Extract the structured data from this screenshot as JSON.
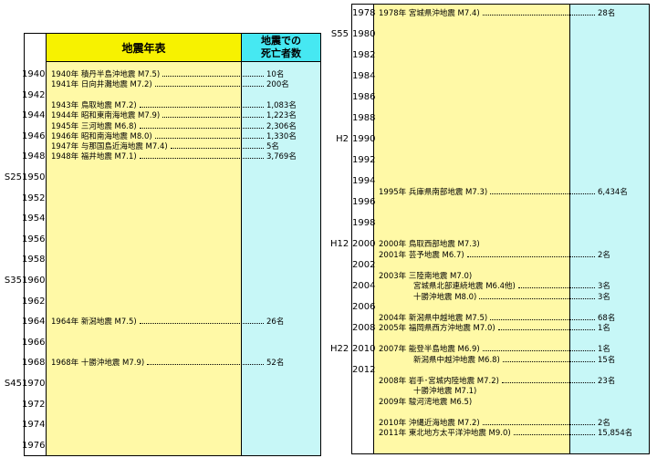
{
  "headers": {
    "main": "地震年表",
    "death": "地震での\n死亡者数"
  },
  "left": {
    "years": [
      "1940",
      "1942",
      "1944",
      "1946",
      "1948",
      "1950",
      "1952",
      "1954",
      "1956",
      "1958",
      "1960",
      "1962",
      "1964",
      "1966",
      "1968",
      "1970",
      "1972",
      "1974",
      "1976"
    ],
    "eras": [
      {
        "label": "S25",
        "year": "1950"
      },
      {
        "label": "S35",
        "year": "1960"
      },
      {
        "label": "S45",
        "year": "1970"
      }
    ],
    "events": [
      {
        "t": "1940年 積丹半島沖地震 M7.5)",
        "d": "10名",
        "row": 0.0
      },
      {
        "t": "1941年 日向井灘地震 M7.2)",
        "d": "200名",
        "row": 0.5
      },
      {
        "t": "1943年 鳥取地震 M7.2)",
        "d": "1,083名",
        "row": 1.5
      },
      {
        "t": "1944年 昭和東南海地震 M7.9)",
        "d": "1,223名",
        "row": 2.0
      },
      {
        "t": "1945年 三河地震 M6.8)",
        "d": "2,306名",
        "row": 2.5
      },
      {
        "t": "1946年 昭和南海地震 M8.0)",
        "d": "1,330名",
        "row": 3.0
      },
      {
        "t": "1947年 与那国島近海地震 M7.4)",
        "d": "5名",
        "row": 3.5
      },
      {
        "t": "1948年 福井地震 M7.1)",
        "d": "3,769名",
        "row": 4.0
      },
      {
        "t": "1964年 新潟地震 M7.5)",
        "d": "26名",
        "row": 12.0
      },
      {
        "t": "1968年 十勝沖地震 M7.9)",
        "d": "52名",
        "row": 14.0
      }
    ]
  },
  "right": {
    "years": [
      "1978",
      "1980",
      "1982",
      "1984",
      "1986",
      "1988",
      "1990",
      "1992",
      "1994",
      "1996",
      "1998",
      "2000",
      "2002",
      "2004",
      "2006",
      "2008",
      "2010",
      "2012"
    ],
    "eras": [
      {
        "label": "S55",
        "year": "1980"
      },
      {
        "label": "H2",
        "year": "1990"
      },
      {
        "label": "H12",
        "year": "2000"
      },
      {
        "label": "H22",
        "year": "2010"
      }
    ],
    "events": [
      {
        "t": "1978年 宮城県沖地震 M7.4)",
        "d": "28名",
        "row": 0.0
      },
      {
        "t": "1995年 兵庫県南部地震 M7.3)",
        "d": "6,434名",
        "row": 8.5
      },
      {
        "t": "2000年 鳥取西部地震 M7.3)",
        "d": "",
        "row": 11.0
      },
      {
        "t": "2001年 芸予地震 M6.7)",
        "d": "2名",
        "row": 11.5
      },
      {
        "t": "2003年 三陸南地震 M7.0)",
        "d": "",
        "row": 12.5
      },
      {
        "t": "宮城県北部連続地震 M6.4他)",
        "d": "3名",
        "row": 13.0,
        "indent": true
      },
      {
        "t": "十勝沖地震 M8.0)",
        "d": "3名",
        "row": 13.5,
        "indent": true
      },
      {
        "t": "2004年 新潟県中越地震 M7.5)",
        "d": "68名",
        "row": 14.5
      },
      {
        "t": "2005年 福岡県西方沖地震 M7.0)",
        "d": "1名",
        "row": 15.0
      },
      {
        "t": "2007年 能登半島地震 M6.9)",
        "d": "1名",
        "row": 16.0
      },
      {
        "t": "新潟県中越沖地震 M6.8)",
        "d": "15名",
        "row": 16.5,
        "indent": true
      },
      {
        "t": "2008年 岩手･宮城内陸地震 M7.2)",
        "d": "23名",
        "row": 17.5
      },
      {
        "t": "十勝沖地震 M7.1)",
        "d": "",
        "row": 18.0,
        "indent": true
      },
      {
        "t": "2009年 駿河湾地震 M6.5)",
        "d": "",
        "row": 18.5
      },
      {
        "t": "2010年 沖縄近海地震 M7.2)",
        "d": "2名",
        "row": 19.5
      },
      {
        "t": "2011年 東北地方太平洋沖地震 M9.0)",
        "d": "15,854名",
        "row": 20.0
      }
    ]
  }
}
